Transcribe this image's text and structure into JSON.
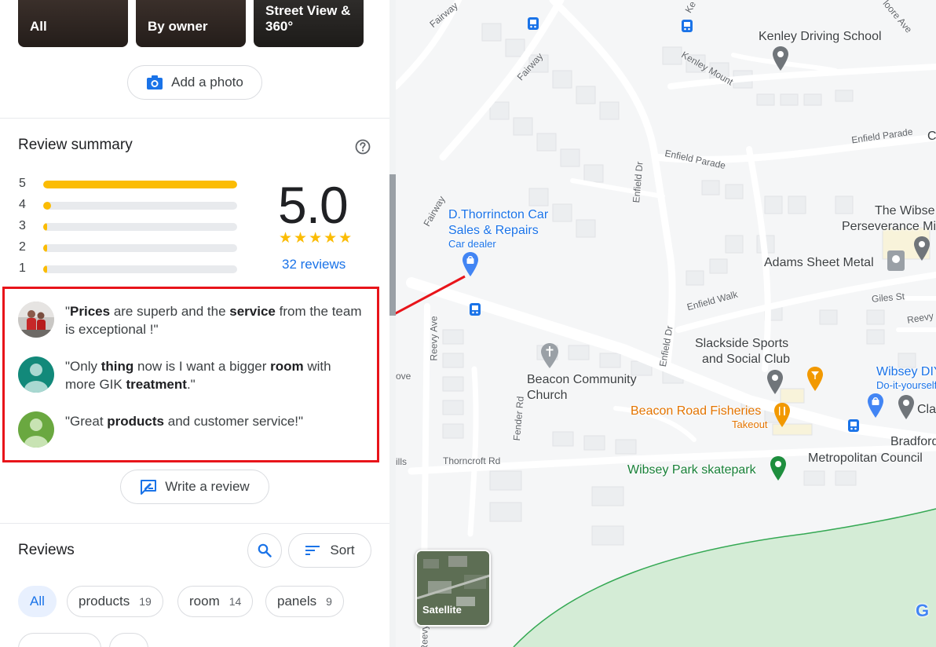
{
  "photos": {
    "all_label": "All",
    "owner_label": "By owner",
    "street_view_label": "Street View & 360°"
  },
  "add_photo": {
    "label": "Add a photo"
  },
  "review_summary": {
    "title": "Review summary",
    "distribution": [
      {
        "stars": "5",
        "fraction": 1.0
      },
      {
        "stars": "4",
        "fraction": 0.04
      },
      {
        "stars": "3",
        "fraction": 0.01
      },
      {
        "stars": "2",
        "fraction": 0.01
      },
      {
        "stars": "1",
        "fraction": 0.01
      }
    ],
    "rating": "5.0",
    "stars_glyphs": "★★★★★",
    "reviews_count": "32 reviews"
  },
  "snippets": [
    {
      "pre": "\"",
      "b1": "Prices",
      "mid1": " are superb and the ",
      "b2": "service",
      "mid2": " from the team is exceptional !\"",
      "b3": "",
      "post": ""
    },
    {
      "pre": "\"Only ",
      "b1": "thing",
      "mid1": " now is I want a bigger ",
      "b2": "room",
      "mid2": " with more GIK ",
      "b3": "treatment",
      "post": ".\""
    },
    {
      "pre": "\"Great ",
      "b1": "products",
      "mid1": " and customer service!\"",
      "b2": "",
      "mid2": "",
      "b3": "",
      "post": ""
    }
  ],
  "write_review": {
    "label": "Write a review"
  },
  "reviews": {
    "title": "Reviews",
    "sort_label": "Sort",
    "chips": [
      {
        "label": "All",
        "count": ""
      },
      {
        "label": "products",
        "count": "19"
      },
      {
        "label": "room",
        "count": "14"
      },
      {
        "label": "panels",
        "count": "9"
      }
    ]
  },
  "map": {
    "places": {
      "kenley": "Kenley Driving School",
      "dealer_line1": "D.Thorrincton Car",
      "dealer_line2": "Sales & Repairs",
      "dealer_type": "Car dealer",
      "wibsey_1": "The Wibse",
      "wibsey_2": "Perseverance Mi",
      "adams": "Adams Sheet Metal",
      "slackside_1": "Slackside Sports",
      "slackside_2": "and Social Club",
      "beacon_church_1": "Beacon Community",
      "beacon_church_2": "Church",
      "fisheries": "Beacon Road Fisheries",
      "fisheries_type": "Takeout",
      "diy_1": "Wibsey DIY C",
      "diy_2": "Do-it-yourself sho",
      "cla": "Cla",
      "bradford_1": "Bradford",
      "bradford_2": "Metropolitan Council",
      "skatepark": "Wibsey Park skatepark",
      "c_edge": "C"
    },
    "streets": {
      "fairway_top": "Fairway",
      "fairway_mid": "Fairway",
      "fairway_left": "Fairway",
      "kenley_mount": "Kenley Mount",
      "moore_ave": "loore Ave",
      "enfield_parade_1": "Enfield Parade",
      "enfield_parade_2": "Enfield Parade",
      "enfield_dr_1": "Enfield Dr",
      "enfield_dr_2": "Enfield Dr",
      "enfield_walk": "Enfield Walk",
      "giles_st": "Giles St",
      "reevy_1": "Reevy",
      "reevy_ave": "Reevy Ave",
      "reevy_ave_2": "Reevy Ave",
      "fender_rd": "Fender Rd",
      "thorncroft_rd": "Thorncroft Rd",
      "grove": "ove",
      "hills": "ills",
      "ke_top": "Ke"
    },
    "satellite_label": "Satellite",
    "google_letter": "G"
  },
  "colors": {
    "accent_blue": "#1a73e8",
    "star_yellow": "#fbbc04",
    "highlight_red": "#e8141a",
    "park_green": "#d4ecd6"
  }
}
